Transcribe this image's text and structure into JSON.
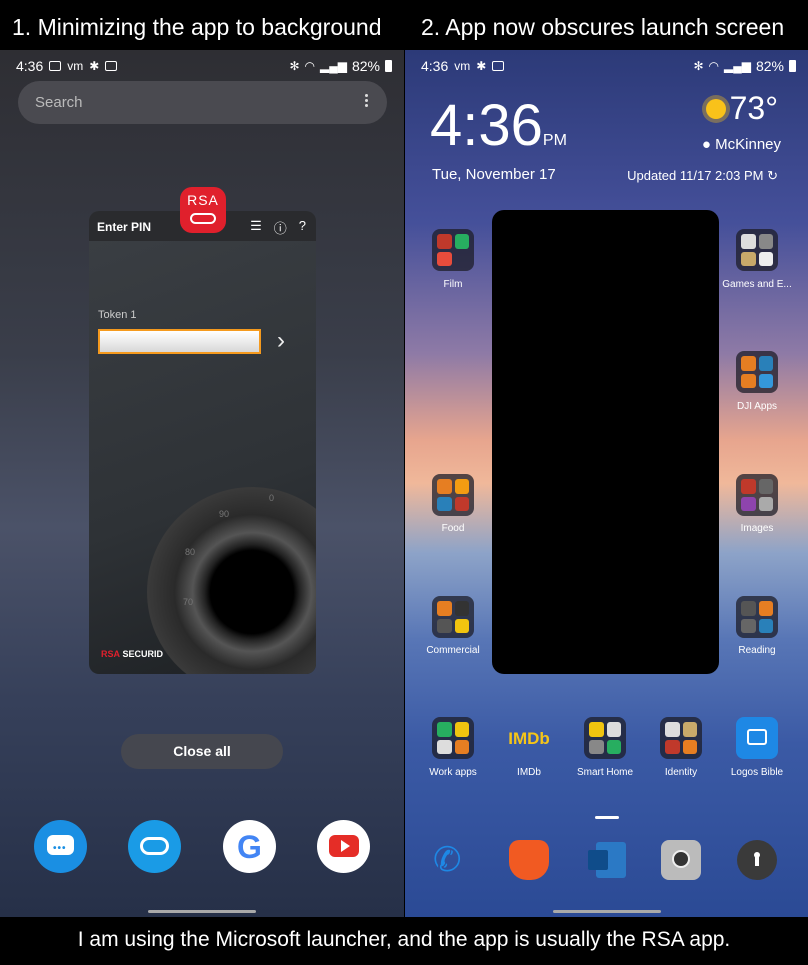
{
  "captions": {
    "left": "1. Minimizing the app to background",
    "right": "2. App now obscures launch screen",
    "bottom": "I am using the Microsoft launcher, and the app is usually the RSA app."
  },
  "left_panel": {
    "status": {
      "time": "4:36",
      "battery": "82%"
    },
    "search": {
      "placeholder": "Search"
    },
    "rsa_card": {
      "title": "Enter PIN",
      "badge": "RSA",
      "token_label": "Token 1",
      "brand": "RSA",
      "brand_sub": "SECURID",
      "dial_numbers": [
        "0",
        "90",
        "80",
        "70"
      ]
    },
    "close_all_label": "Close all",
    "dock": [
      {
        "name": "messages",
        "color": "#1a8fe3"
      },
      {
        "name": "bluetooth-app",
        "color": "#1a8fe3"
      },
      {
        "name": "google",
        "color": "#ffffff"
      },
      {
        "name": "youtube",
        "color": "#ffffff"
      }
    ]
  },
  "right_panel": {
    "status": {
      "time": "4:36",
      "battery": "82%"
    },
    "clock": {
      "time": "4:36",
      "ampm": "PM"
    },
    "date": "Tue, November 17",
    "weather": {
      "temp": "73°",
      "location": "McKinney",
      "updated": "Updated 11/17 2:03 PM"
    },
    "folders_left": [
      "Film",
      "Food",
      "Commercial"
    ],
    "folders_right": [
      "Games and E...",
      "DJI Apps",
      "Images",
      "Reading"
    ],
    "app_row": [
      "Work apps",
      "IMDb",
      "Smart Home",
      "Identity",
      "Logos Bible"
    ],
    "imdb_text": "IMDb",
    "dock": [
      "phone",
      "brave",
      "outlook",
      "camera",
      "keyhole"
    ]
  }
}
